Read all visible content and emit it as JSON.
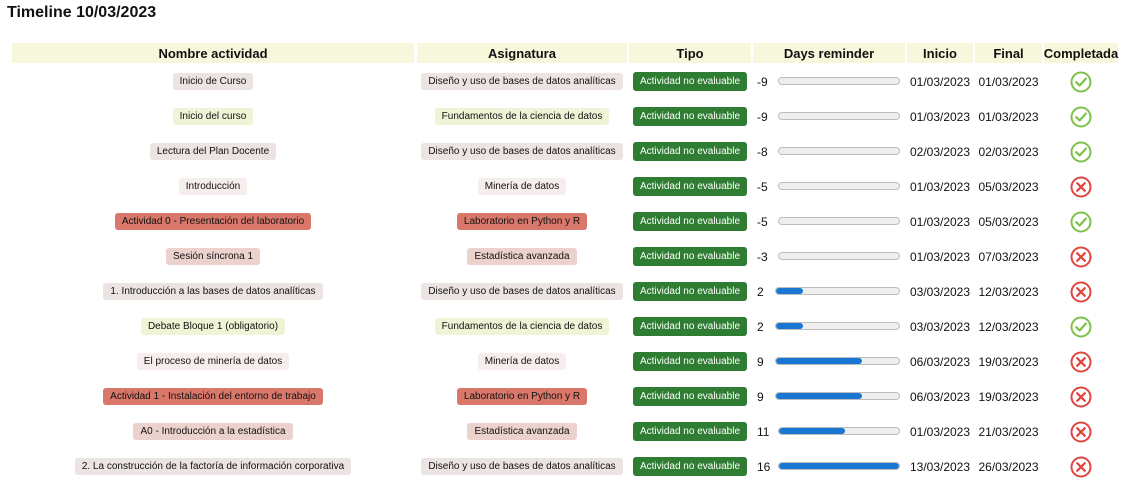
{
  "title": "Timeline 10/03/2023",
  "headers": {
    "actividad": "Nombre actividad",
    "asignatura": "Asignatura",
    "tipo": "Tipo",
    "days": "Days reminder",
    "inicio": "Inicio",
    "final": "Final",
    "completada": "Completada"
  },
  "colors": {
    "header_bg": "#f7f7dc",
    "tipo_bg": "#2e7d32",
    "bar_fill": "#1976d2",
    "check": "#7cc24a",
    "cross": "#e0463e"
  },
  "rows": [
    {
      "actividad": "Inicio de Curso",
      "actividad_color": "#ece4e2",
      "asignatura": "Diseño y uso de bases de datos analíticas",
      "asignatura_color": "#ece4e2",
      "tipo": "Actividad no evaluable",
      "days": "-9",
      "progress": 0,
      "inicio": "01/03/2023",
      "final": "01/03/2023",
      "completada": true
    },
    {
      "actividad": "Inicio del curso",
      "actividad_color": "#eef5d6",
      "asignatura": "Fundamentos de la ciencia de datos",
      "asignatura_color": "#eef5d6",
      "tipo": "Actividad no evaluable",
      "days": "-9",
      "progress": 0,
      "inicio": "01/03/2023",
      "final": "01/03/2023",
      "completada": true
    },
    {
      "actividad": "Lectura del Plan Docente",
      "actividad_color": "#ece4e2",
      "asignatura": "Diseño y uso de bases de datos analíticas",
      "asignatura_color": "#ece4e2",
      "tipo": "Actividad no evaluable",
      "days": "-8",
      "progress": 0,
      "inicio": "02/03/2023",
      "final": "02/03/2023",
      "completada": true
    },
    {
      "actividad": "Introducción",
      "actividad_color": "#f6eeec",
      "asignatura": "Minería de datos",
      "asignatura_color": "#f6eeec",
      "tipo": "Actividad no evaluable",
      "days": "-5",
      "progress": 0,
      "inicio": "01/03/2023",
      "final": "05/03/2023",
      "completada": false
    },
    {
      "actividad": "Actividad 0 - Presentación del laboratorio",
      "actividad_color": "#d9786a",
      "asignatura": "Laboratorio en Python y R",
      "asignatura_color": "#d9786a",
      "tipo": "Actividad no evaluable",
      "days": "-5",
      "progress": 0,
      "inicio": "01/03/2023",
      "final": "05/03/2023",
      "completada": true
    },
    {
      "actividad": "Sesión síncrona 1",
      "actividad_color": "#ecd2cd",
      "asignatura": "Estadística avanzada",
      "asignatura_color": "#ecd2cd",
      "tipo": "Actividad no evaluable",
      "days": "-3",
      "progress": 0,
      "inicio": "01/03/2023",
      "final": "07/03/2023",
      "completada": false
    },
    {
      "actividad": "1. Introducción a las bases de datos analíticas",
      "actividad_color": "#ece4e2",
      "asignatura": "Diseño y uso de bases de datos analíticas",
      "asignatura_color": "#ece4e2",
      "tipo": "Actividad no evaluable",
      "days": "2",
      "progress": 0.22,
      "inicio": "03/03/2023",
      "final": "12/03/2023",
      "completada": false
    },
    {
      "actividad": "Debate Bloque 1 (obligatorio)",
      "actividad_color": "#eef5d6",
      "asignatura": "Fundamentos de la ciencia de datos",
      "asignatura_color": "#eef5d6",
      "tipo": "Actividad no evaluable",
      "days": "2",
      "progress": 0.22,
      "inicio": "03/03/2023",
      "final": "12/03/2023",
      "completada": true
    },
    {
      "actividad": "El proceso de minería de datos",
      "actividad_color": "#f6eeec",
      "asignatura": "Minería de datos",
      "asignatura_color": "#f6eeec",
      "tipo": "Actividad no evaluable",
      "days": "9",
      "progress": 0.7,
      "inicio": "06/03/2023",
      "final": "19/03/2023",
      "completada": false
    },
    {
      "actividad": "Actividad 1 - Instalación del entorno de trabajo",
      "actividad_color": "#d9786a",
      "asignatura": "Laboratorio en Python y R",
      "asignatura_color": "#d9786a",
      "tipo": "Actividad no evaluable",
      "days": "9",
      "progress": 0.7,
      "inicio": "06/03/2023",
      "final": "19/03/2023",
      "completada": false
    },
    {
      "actividad": "A0 - Introducción a la estadística",
      "actividad_color": "#ecd2cd",
      "asignatura": "Estadística avanzada",
      "asignatura_color": "#ecd2cd",
      "tipo": "Actividad no evaluable",
      "days": "11",
      "progress": 0.55,
      "inicio": "01/03/2023",
      "final": "21/03/2023",
      "completada": false
    },
    {
      "actividad": "2. La construcción de la factoría de información corporativa",
      "actividad_color": "#ece4e2",
      "asignatura": "Diseño y uso de bases de datos analíticas",
      "asignatura_color": "#ece4e2",
      "tipo": "Actividad no evaluable",
      "days": "16",
      "progress": 1.0,
      "inicio": "13/03/2023",
      "final": "26/03/2023",
      "completada": false
    }
  ]
}
